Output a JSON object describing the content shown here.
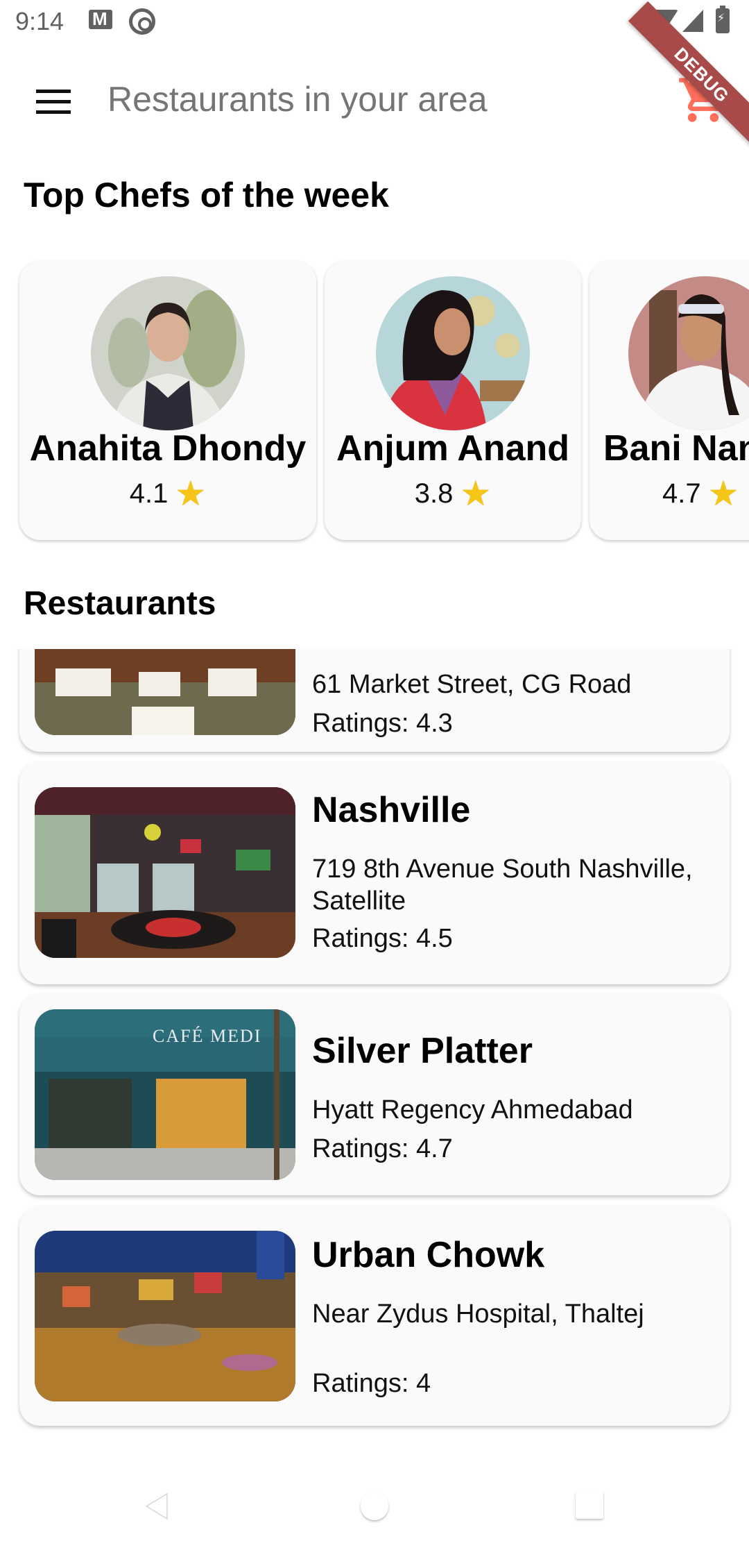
{
  "status_bar": {
    "time": "9:14",
    "icons": [
      "gmail-icon",
      "at-sign-icon",
      "wifi-icon",
      "cell-signal-icon",
      "battery-charging-icon"
    ]
  },
  "app_bar": {
    "menu_icon": "hamburger-menu-icon",
    "title": "Restaurants in your area",
    "cart_icon": "shopping-cart-icon",
    "debug_banner": "DEBUG",
    "accent_color": "#ff6e5a"
  },
  "chefs_section": {
    "title": "Top Chefs of the week",
    "chefs": [
      {
        "name": "Anahita Dhondy",
        "rating": "4.1",
        "star_icon": "★"
      },
      {
        "name": "Anjum Anand",
        "rating": "3.8",
        "star_icon": "★"
      },
      {
        "name": "Bani Nanda",
        "rating": "4.7",
        "star_icon": "★"
      }
    ]
  },
  "restaurants_section": {
    "title": "Restaurants",
    "items": [
      {
        "name": "",
        "address": "61 Market Street, CG Road",
        "rating_label": "Ratings: 4.3"
      },
      {
        "name": "Nashville",
        "address": "719 8th Avenue South Nashville, Satellite",
        "rating_label": "Ratings: 4.5"
      },
      {
        "name": "Silver Platter",
        "address": "Hyatt Regency Ahmedabad",
        "rating_label": "Ratings: 4.7",
        "image_sign": "CAFÉ MEDI"
      },
      {
        "name": "Urban Chowk",
        "address": "Near Zydus Hospital, Thaltej",
        "rating_label": "Ratings: 4"
      }
    ]
  },
  "nav_bar": {
    "buttons": [
      "back-icon",
      "home-icon",
      "recents-icon"
    ]
  }
}
